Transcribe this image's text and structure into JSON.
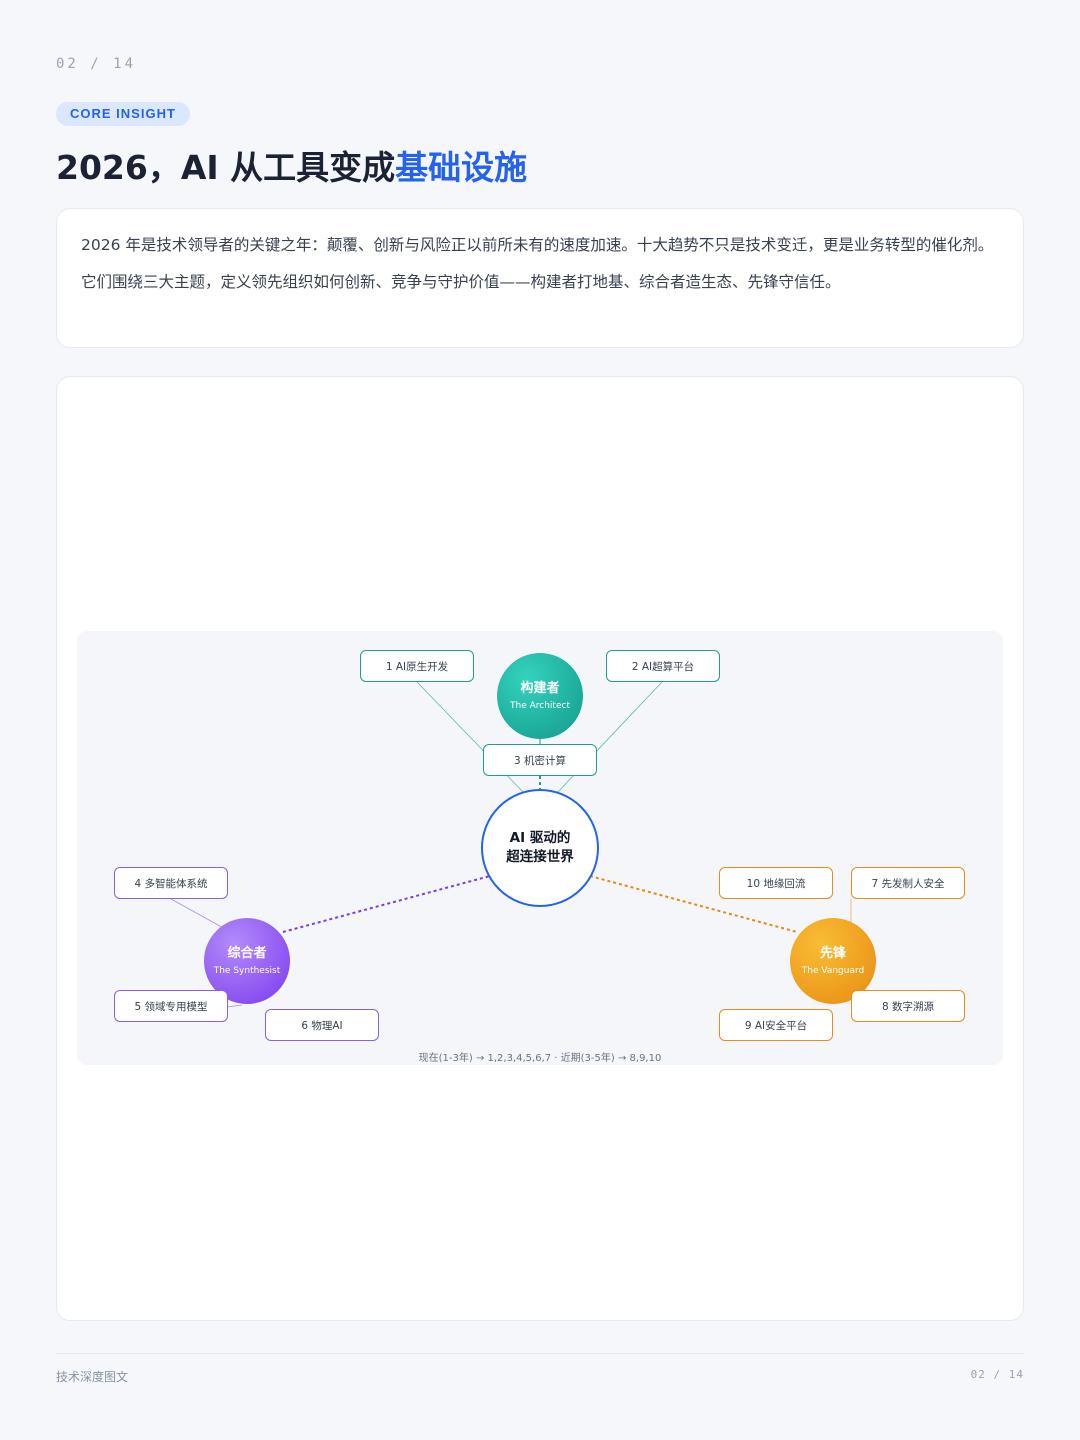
{
  "page": {
    "indicator": "02 / 14"
  },
  "badge": "CORE INSIGHT",
  "title": {
    "main": "2026，AI 从工具变成",
    "highlight": "基础设施"
  },
  "intro": {
    "p1": "2026 年是技术领导者的关键之年：颠覆、创新与风险正以前所未有的速度加速。十大趋势不只是技术变迁，更是业务转型的催化剂。",
    "p2": "它们围绕三大主题，定义领先组织如何创新、竞争与守护价值——构建者打地基、综合者造生态、先锋守信任。"
  },
  "diagram": {
    "center": {
      "line1": "AI 驱动的",
      "line2": "超连接世界"
    },
    "architect": {
      "name": "构建者",
      "subtitle": "The Architect",
      "items": [
        "1 AI原生开发",
        "2 AI超算平台",
        "3 机密计算"
      ]
    },
    "synthesist": {
      "name": "综合者",
      "subtitle": "The Synthesist",
      "items": [
        "4 多智能体系统",
        "5 领域专用模型",
        "6 物理AI"
      ]
    },
    "vanguard": {
      "name": "先锋",
      "subtitle": "The Vanguard",
      "items": [
        "7 先发制人安全",
        "8 数字溯源",
        "9 AI安全平台",
        "10 地缘回流"
      ]
    },
    "caption": "现在(1-3年) → 1,2,3,4,5,6,7 · 近期(3-5年) → 8,9,10",
    "colors": {
      "architect": "#1f9e8e",
      "synthesist": "#8b5cf6",
      "vanguard": "#ea8a1f",
      "center": "#2563eb"
    }
  },
  "footer": {
    "left": "技术深度图文",
    "right": "02 / 14"
  }
}
